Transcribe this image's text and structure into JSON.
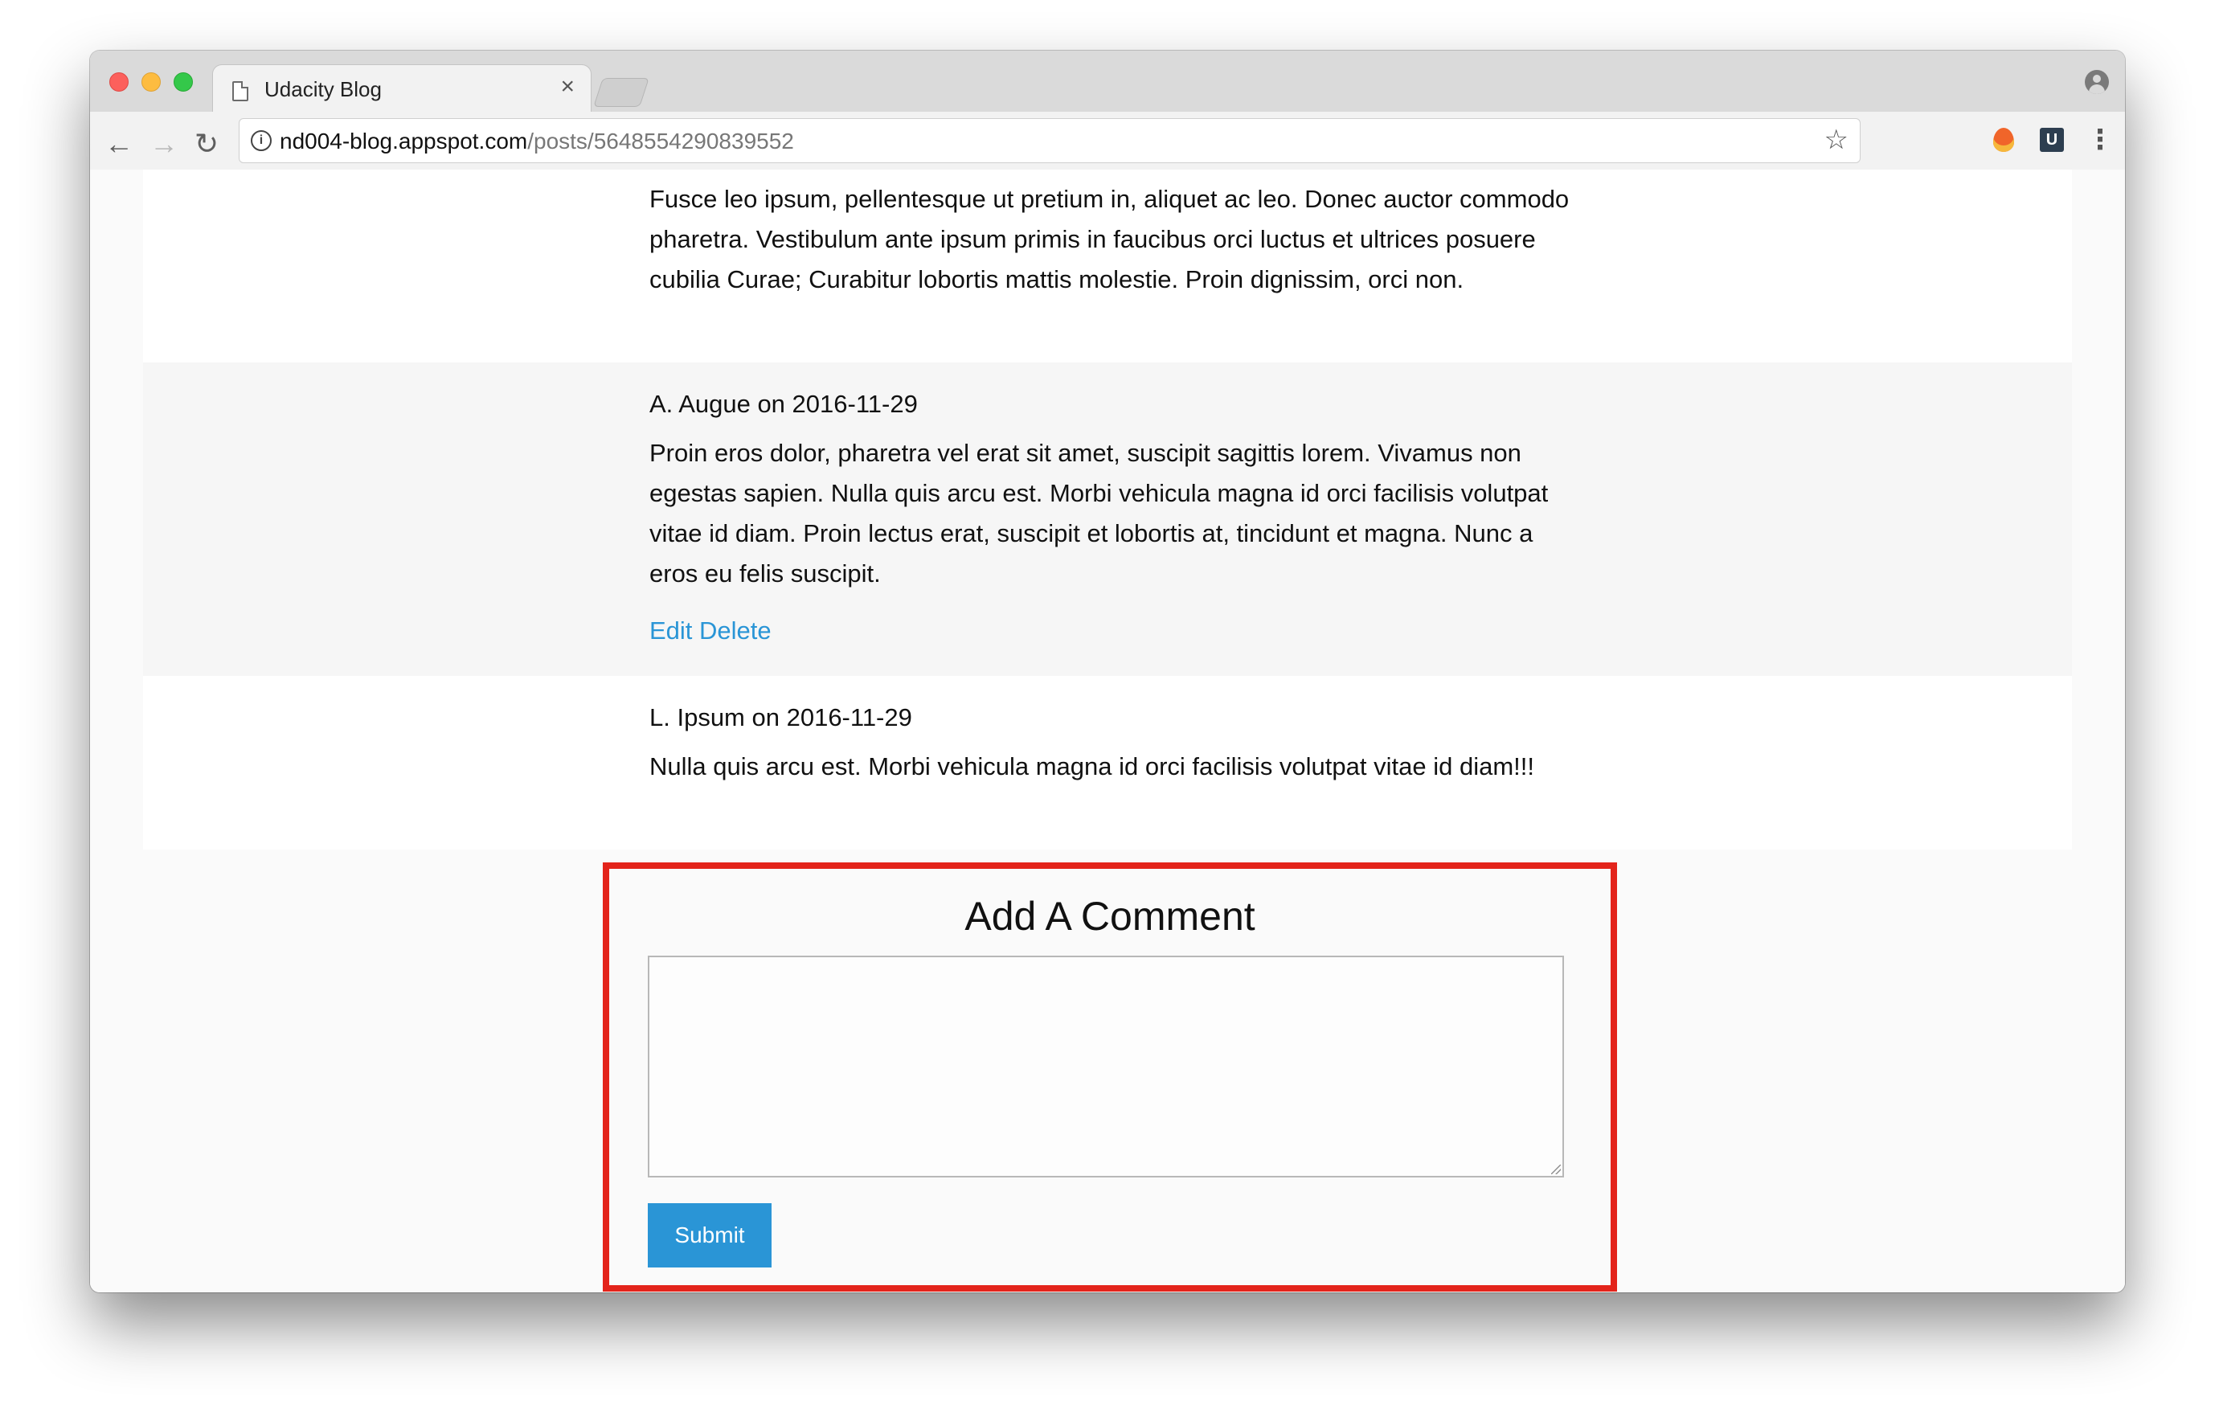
{
  "browser": {
    "tab_title": "Udacity Blog",
    "tab_close": "×",
    "url_host": "nd004-blog.appspot.com",
    "url_path": "/posts/5648554290839552",
    "info_icon": "i",
    "extension_u": "U"
  },
  "comments": [
    {
      "meta": "",
      "text": "Fusce leo ipsum, pellentesque ut pretium in, aliquet ac leo. Donec auctor commodo pharetra. Vestibulum ante ipsum primis in faucibus orci luctus et ultrices posuere cubilia Curae; Curabitur lobortis mattis molestie. Proin dignissim, orci non."
    },
    {
      "meta": "A. Augue on 2016-11-29",
      "text": "Proin eros dolor, pharetra vel erat sit amet, suscipit sagittis lorem. Vivamus non egestas sapien. Nulla quis arcu est. Morbi vehicula magna id orci facilisis volutpat vitae id diam. Proin lectus erat, suscipit et lobortis at, tincidunt et magna. Nunc a eros eu felis suscipit.",
      "edit_label": "Edit",
      "delete_label": "Delete"
    },
    {
      "meta": "L. Ipsum on 2016-11-29",
      "text": "Nulla quis arcu est. Morbi vehicula magna id orci facilisis volutpat vitae id diam!!!"
    }
  ],
  "comment_form": {
    "title": "Add A Comment",
    "textarea_value": "",
    "submit_label": "Submit"
  },
  "colors": {
    "link": "#2a95d6",
    "highlight_border": "#e3241b"
  }
}
